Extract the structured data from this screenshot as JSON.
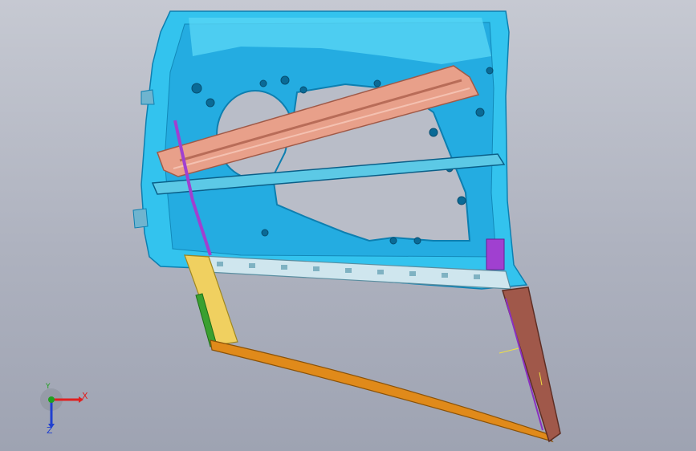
{
  "viewport": {
    "background_top": "#c6c9d2",
    "background_bottom": "#9ea3b2"
  },
  "model": {
    "parts": {
      "inner_panel": "#33c3ee",
      "inner_panel_edge": "#0d7fb0",
      "window_regulator_rail": "#e8a08a",
      "belt_reinforcement": "#5cc9e6",
      "lower_beltline_strip": "#cfe6ee",
      "glass_run_front": "#f0d060",
      "glass_run_green": "#3aa030",
      "glass_frame_bottom": "#e08a1a",
      "rear_channel": "#a0584a",
      "purple_bracket": "#a040d0"
    }
  },
  "triad": {
    "x_label": "X",
    "y_label": "Y",
    "z_label": "Z",
    "x_color": "#e02020",
    "y_color": "#20a020",
    "z_color": "#2040d0"
  }
}
